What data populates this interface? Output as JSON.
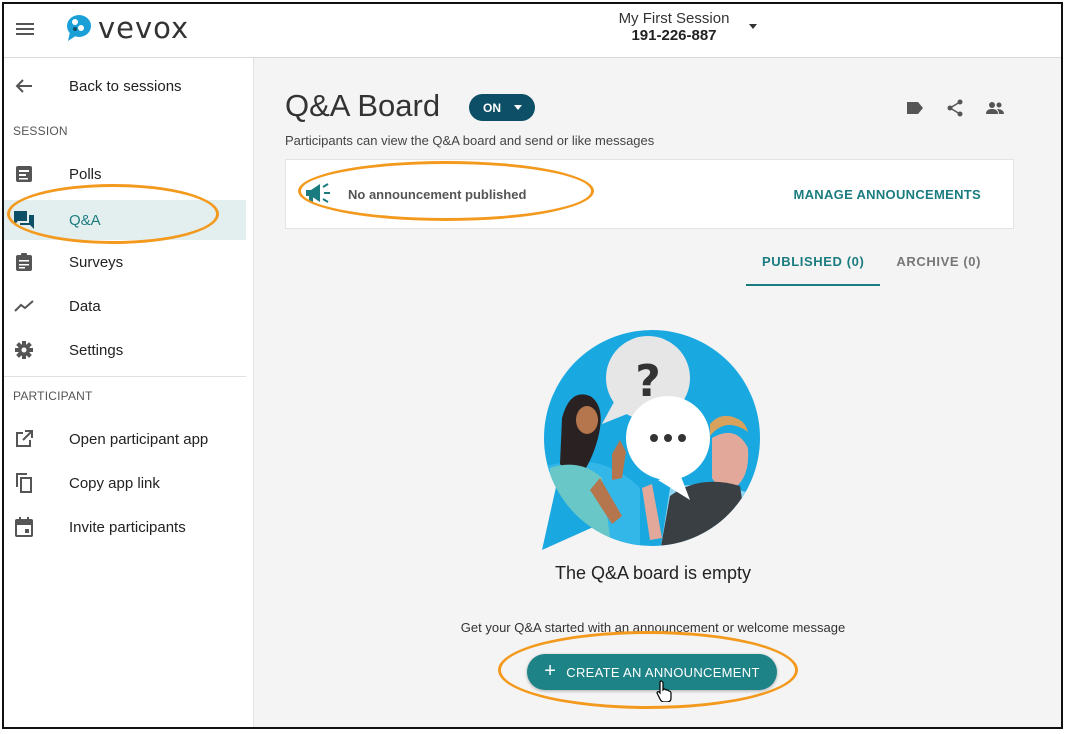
{
  "header": {
    "brand": "vevox",
    "session_name": "My First Session",
    "session_code": "191-226-887"
  },
  "sidebar": {
    "back_label": "Back to sessions",
    "session_header": "SESSION",
    "items": [
      {
        "label": "Polls",
        "icon": "poll-icon"
      },
      {
        "label": "Q&A",
        "icon": "chat-icon",
        "active": true
      },
      {
        "label": "Surveys",
        "icon": "clipboard-icon"
      },
      {
        "label": "Data",
        "icon": "trend-icon"
      },
      {
        "label": "Settings",
        "icon": "gear-icon"
      }
    ],
    "participant_header": "PARTICIPANT",
    "participant_items": [
      {
        "label": "Open participant app",
        "icon": "external-link-icon"
      },
      {
        "label": "Copy app link",
        "icon": "copy-icon"
      },
      {
        "label": "Invite participants",
        "icon": "calendar-icon"
      }
    ]
  },
  "main": {
    "title": "Q&A Board",
    "status_toggle": "ON",
    "subtitle": "Participants can view the Q&A board and send or like messages",
    "announcement": {
      "text": "No announcement published",
      "manage_label": "MANAGE ANNOUNCEMENTS"
    },
    "tabs": [
      {
        "label": "PUBLISHED (0)",
        "active": true
      },
      {
        "label": "ARCHIVE (0)",
        "active": false
      }
    ],
    "empty_title": "The Q&A board is empty",
    "empty_subtitle": "Get your Q&A started with an announcement or welcome message",
    "create_button": "CREATE AN ANNOUNCEMENT"
  },
  "colors": {
    "accent": "#1b7c80",
    "toggle_bg": "#0d4f66",
    "highlight": "#f39a1e"
  }
}
